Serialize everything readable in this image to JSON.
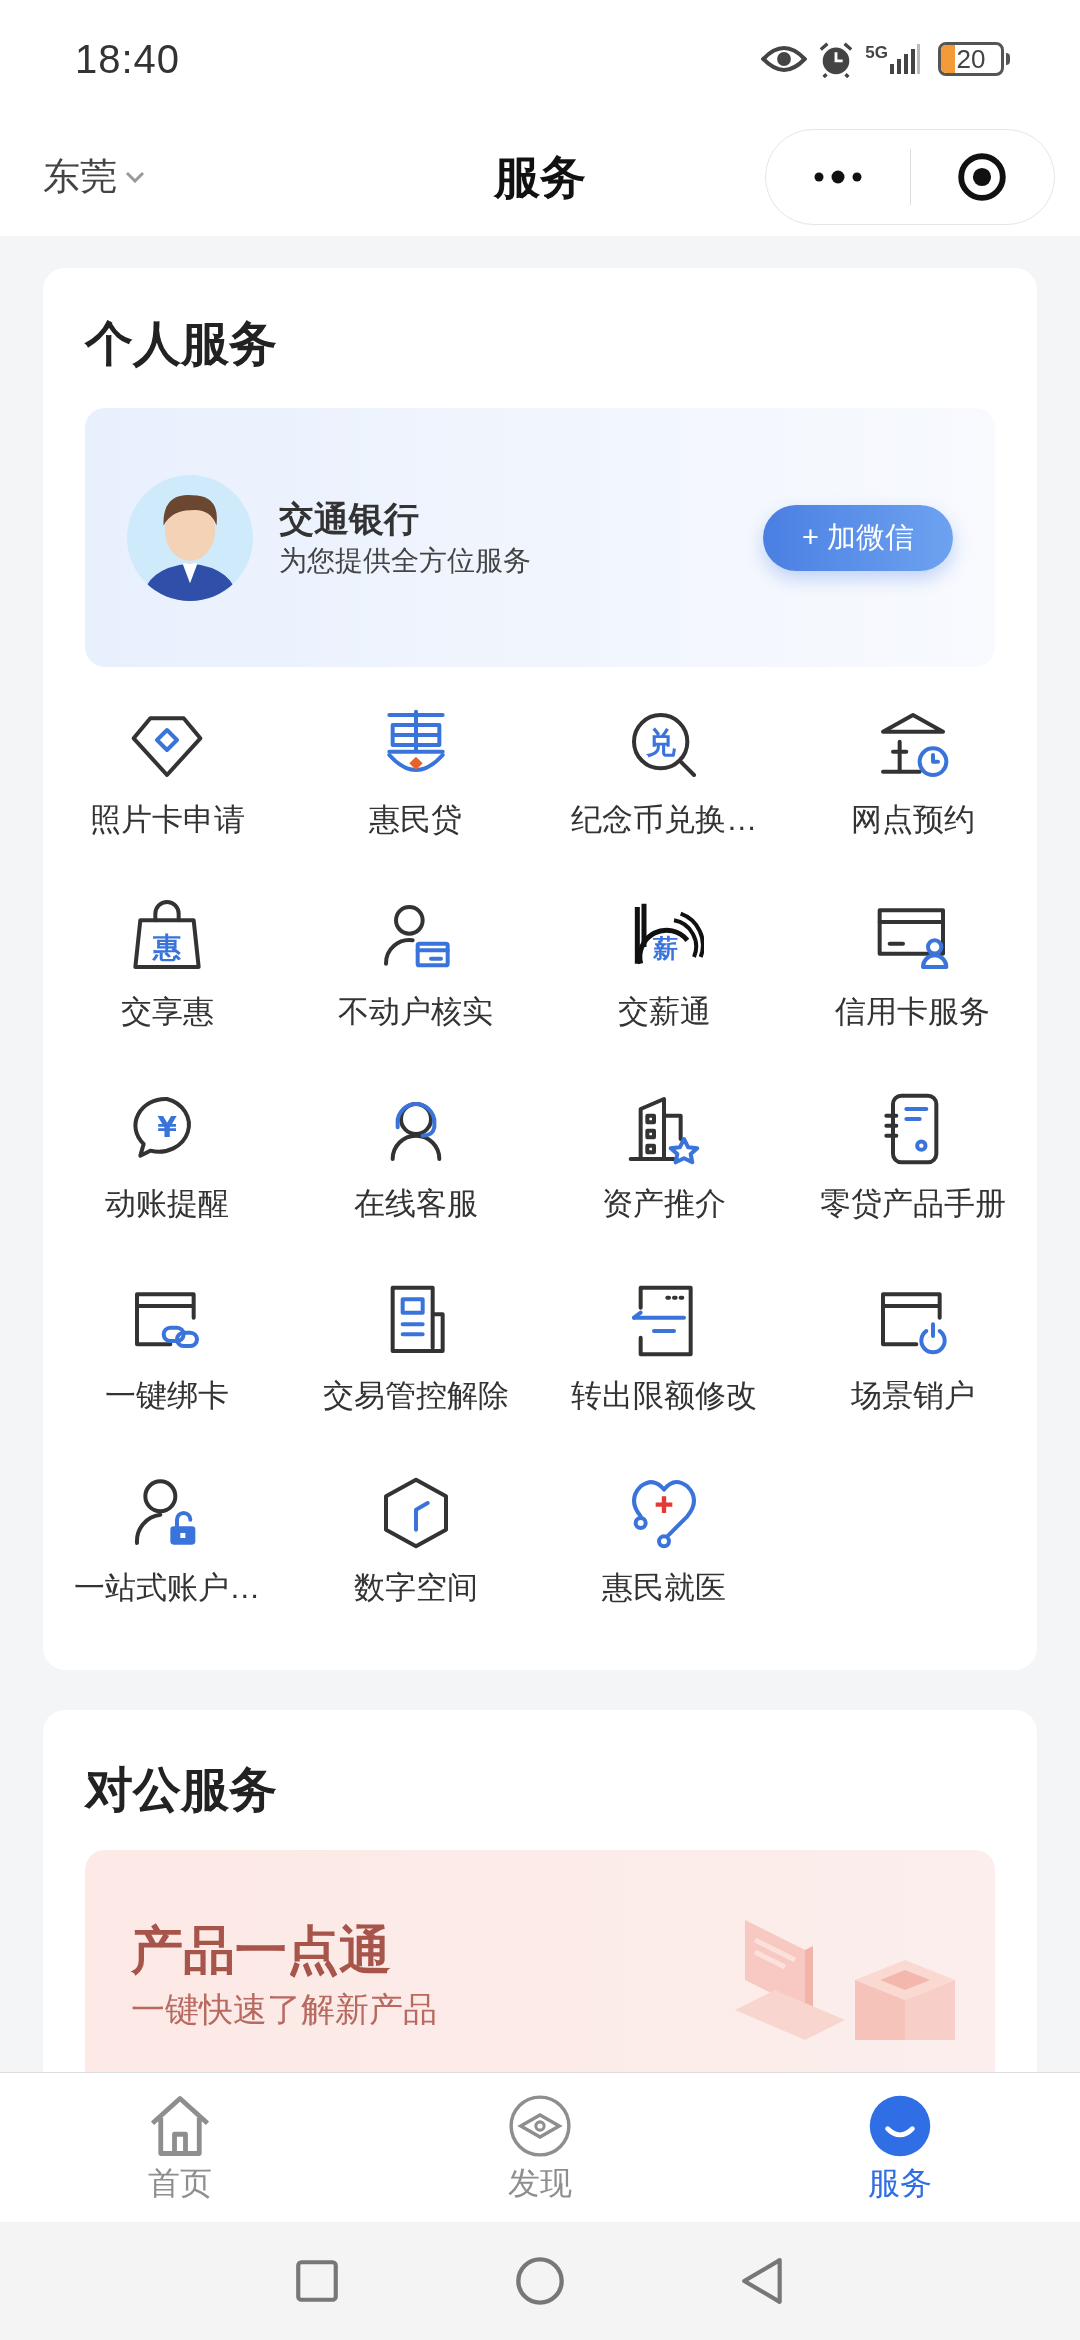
{
  "status_bar": {
    "time": "18:40",
    "network": "5G",
    "battery": "20"
  },
  "header": {
    "city": "东莞",
    "title": "服务"
  },
  "personal": {
    "title": "个人服务",
    "banner": {
      "name": "交通银行",
      "subtitle": "为您提供全方位服务",
      "button": "+ 加微信"
    },
    "services": [
      {
        "label": "照片卡申请",
        "kind": "diamond"
      },
      {
        "label": "惠民贷",
        "kind": "emblem"
      },
      {
        "label": "纪念币兑换…",
        "kind": "magnifier",
        "icon_text": "兑"
      },
      {
        "label": "网点预约",
        "kind": "bank-clock"
      },
      {
        "label": "交享惠",
        "kind": "bag",
        "icon_text": "惠"
      },
      {
        "label": "不动户核实",
        "kind": "person-card"
      },
      {
        "label": "交薪通",
        "kind": "arcs",
        "icon_text": "薪"
      },
      {
        "label": "信用卡服务",
        "kind": "card-person"
      },
      {
        "label": "动账提醒",
        "kind": "bubble",
        "icon_text": "¥"
      },
      {
        "label": "在线客服",
        "kind": "headset"
      },
      {
        "label": "资产推介",
        "kind": "building-star"
      },
      {
        "label": "零贷产品手册",
        "kind": "notebook"
      },
      {
        "label": "一键绑卡",
        "kind": "card-link"
      },
      {
        "label": "交易管控解除",
        "kind": "document"
      },
      {
        "label": "转出限额修改",
        "kind": "list-doc"
      },
      {
        "label": "场景销户",
        "kind": "card-power"
      },
      {
        "label": "一站式账户…",
        "kind": "person-lock"
      },
      {
        "label": "数字空间",
        "kind": "cube"
      },
      {
        "label": "惠民就医",
        "kind": "heart"
      }
    ]
  },
  "corporate": {
    "title": "对公服务",
    "banner": {
      "title": "产品一点通",
      "subtitle": "一键快速了解新产品"
    }
  },
  "tabs": [
    {
      "label": "首页",
      "kind": "home",
      "selected": false
    },
    {
      "label": "发现",
      "kind": "discover",
      "selected": false
    },
    {
      "label": "服务",
      "kind": "service",
      "selected": true
    }
  ]
}
